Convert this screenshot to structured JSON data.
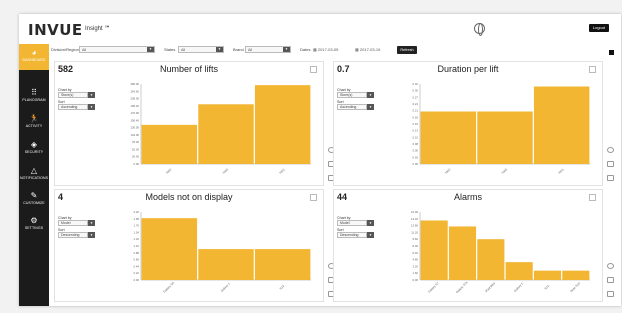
{
  "app": {
    "brand": "INVUE",
    "product": "Insight ℠",
    "logout_label": "Logout"
  },
  "sidebar": {
    "items": [
      {
        "label": "DASHBOARD",
        "icon": "gauge-icon",
        "active": true
      },
      {
        "label": "PLANOGRAM",
        "icon": "grid-icon",
        "active": false
      },
      {
        "label": "ACTIVITY",
        "icon": "running-person-icon",
        "active": false
      },
      {
        "label": "SECURITY",
        "icon": "shield-icon",
        "active": false
      },
      {
        "label": "NOTIFICATIONS",
        "icon": "bell-icon",
        "active": false
      },
      {
        "label": "CUSTOMIZE",
        "icon": "pencil-icon",
        "active": false
      },
      {
        "label": "SETTINGS",
        "icon": "gears-icon",
        "active": false
      }
    ]
  },
  "filters": {
    "division_label": "Division/Region",
    "division_value": "All",
    "states_label": "States",
    "states_value": "All",
    "brand_label": "Brand",
    "brand_value": "All",
    "dates_label": "Dates",
    "date_from": "2017-03-05",
    "date_to": "2017-03-19",
    "refresh_label": "Refresh"
  },
  "controls": {
    "chart_by_label": "Chart by",
    "sort_label": "Sort",
    "sort_value": "Ascending",
    "sort_value_desc": "Descending"
  },
  "colors": {
    "bar": "#f2b632",
    "sidebar": "#1b1b1b",
    "active": "#f2b632"
  },
  "panels": [
    {
      "count": "582",
      "title": "Number of lifts",
      "chart_by": "Store(s)",
      "sort": "Ascending",
      "chart_data": {
        "type": "bar",
        "categories": [
          "7002",
          "7003",
          "7001"
        ],
        "values": [
          137,
          209,
          276
        ],
        "ylim": [
          0,
          280
        ],
        "yticks": [
          "280.00",
          "254.60",
          "228.00",
          "195.20",
          "176.00",
          "156.40",
          "130.00",
          "104.00",
          "78.00",
          "52.00",
          "26.00",
          "0.00"
        ]
      }
    },
    {
      "count": "0.7",
      "title": "Duration per lift",
      "chart_by": "Store(s)",
      "sort": "Ascending",
      "chart_data": {
        "type": "bar",
        "categories": [
          "7002",
          "7003",
          "7001"
        ],
        "values": [
          0.21,
          0.21,
          0.31
        ],
        "ylim": [
          0,
          0.32
        ],
        "yticks": [
          "0.32",
          "0.30",
          "0.27",
          "0.24",
          "0.21",
          "0.18",
          "0.16",
          "0.13",
          "0.10",
          "0.08",
          "0.05",
          "0.03",
          "0.00"
        ]
      }
    },
    {
      "count": "4",
      "title": "Models not on display",
      "chart_by": "Model",
      "sort": "Descending",
      "chart_data": {
        "type": "bar",
        "categories": [
          "Galaxy S8",
          "Galaxy 1",
          "S22"
        ],
        "values": [
          2.0,
          1.0,
          1.0
        ],
        "ylim": [
          0,
          2.2
        ],
        "yticks": [
          "2.20",
          "1.98",
          "1.76",
          "1.54",
          "1.32",
          "1.10",
          "0.88",
          "0.66",
          "0.44",
          "0.22",
          "0.00"
        ]
      }
    },
    {
      "count": "44",
      "title": "Alarms",
      "chart_by": "Model",
      "sort": "Descending",
      "chart_data": {
        "type": "bar",
        "categories": [
          "Galaxy S7",
          "Galaxy S7e",
          "iPad Mini",
          "Galaxy 1",
          "S22",
          "Note S10"
        ],
        "values": [
          14,
          12.6,
          9.6,
          4.2,
          2.2,
          2.2
        ],
        "ylim": [
          0,
          16
        ],
        "yticks": [
          "16.00",
          "14.40",
          "12.80",
          "11.20",
          "9.60",
          "8.00",
          "6.40",
          "4.80",
          "3.20",
          "1.60",
          "0.00"
        ]
      }
    }
  ]
}
